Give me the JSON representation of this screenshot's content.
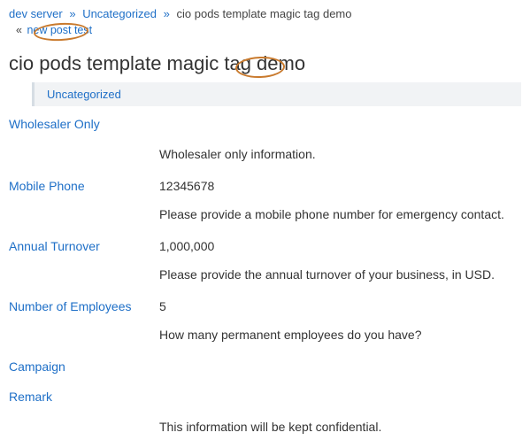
{
  "breadcrumb": {
    "home": "dev server",
    "category": "Uncategorized",
    "current": "cio pods template magic tag demo",
    "sep": "»"
  },
  "nav": {
    "prev_symbol": "«",
    "prev_label": "new post test"
  },
  "title": "cio pods template magic tag demo",
  "category_bar": "Uncategorized",
  "fields": {
    "wholesaler": {
      "label": "Wholesaler Only",
      "value": "",
      "desc": "Wholesaler only information."
    },
    "mobile": {
      "label": "Mobile Phone",
      "value": "12345678",
      "desc": "Please provide a mobile phone number for emergency contact."
    },
    "turnover": {
      "label": "Annual Turnover",
      "value": "1,000,000",
      "desc": "Please provide the annual turnover of your business, in USD."
    },
    "employees": {
      "label": "Number of Employees",
      "value": "5",
      "desc": "How many permanent employees do you have?"
    },
    "campaign": {
      "label": "Campaign"
    },
    "remark": {
      "label": "Remark",
      "desc": "This information will be kept confidential."
    }
  }
}
